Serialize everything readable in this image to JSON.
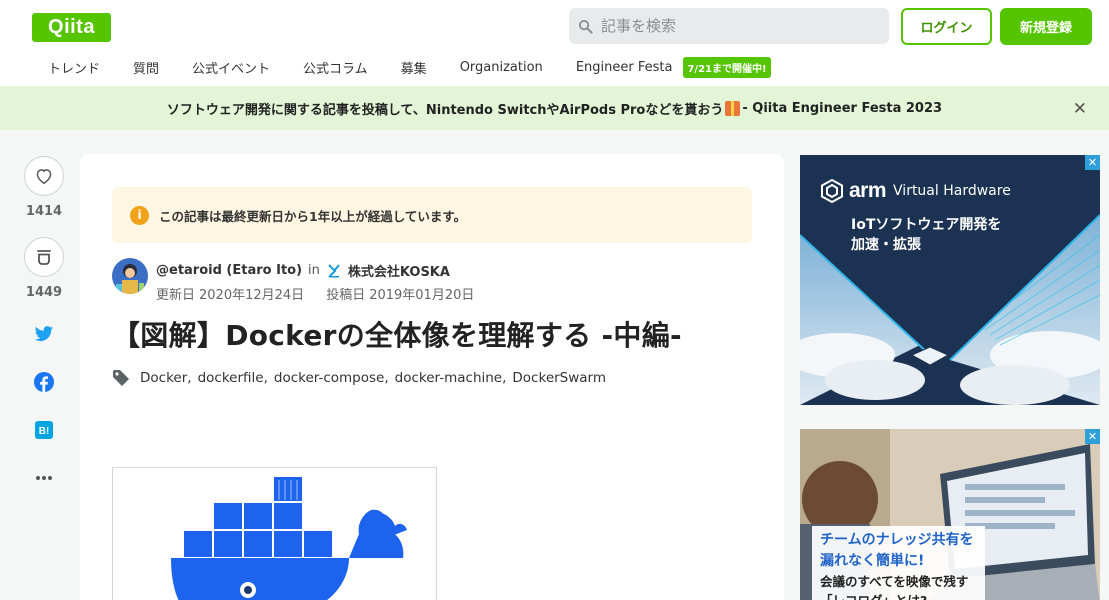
{
  "header": {
    "logo": "Qiita",
    "search_placeholder": "記事を検索",
    "login": "ログイン",
    "signup": "新規登録"
  },
  "nav": {
    "items": [
      "トレンド",
      "質問",
      "公式イベント",
      "公式コラム",
      "募集",
      "Organization",
      "Engineer Festa"
    ],
    "live_badge": "7/21まで開催中!"
  },
  "banner": {
    "text_before": "ソフトウェア開発に関する記事を投稿して、Nintendo SwitchやAirPods Proなどを貰おう",
    "text_after": " - Qiita Engineer Festa 2023",
    "close": "✕"
  },
  "reactions": {
    "likes": "1414",
    "stocks": "1449"
  },
  "article": {
    "notice": "この記事は最終更新日から1年以上が経過しています。",
    "author_handle": "@etaroid (Etaro Ito)",
    "in": "in",
    "organization": "株式会社KOSKA",
    "updated_label": "更新日",
    "updated_date": "2020年12月24日",
    "posted_label": "投稿日",
    "posted_date": "2019年01月20日",
    "title": "【図解】Dockerの全体像を理解する -中編-",
    "tags": [
      "Docker",
      "dockerfile",
      "docker-compose",
      "docker-machine",
      "DockerSwarm"
    ]
  },
  "ads": {
    "ad1": {
      "brand": "arm",
      "product": "Virtual Hardware",
      "line1": "IoTソフトウェア開発を",
      "line2": "加速・拡張"
    },
    "ad2": {
      "headline1": "チームのナレッジ共有を",
      "headline2": "漏れなく簡単に!",
      "sub1": "会議のすべてを映像で残す",
      "sub2": "「レコログ」とは?"
    },
    "close_mark": "✕"
  },
  "colors": {
    "brand_green": "#55c500",
    "banner_bg": "#e3f5d6",
    "notice_bg": "#fdf6e2",
    "twitter": "#1da1f2",
    "facebook": "#1877f2",
    "hatena": "#00a4de"
  }
}
